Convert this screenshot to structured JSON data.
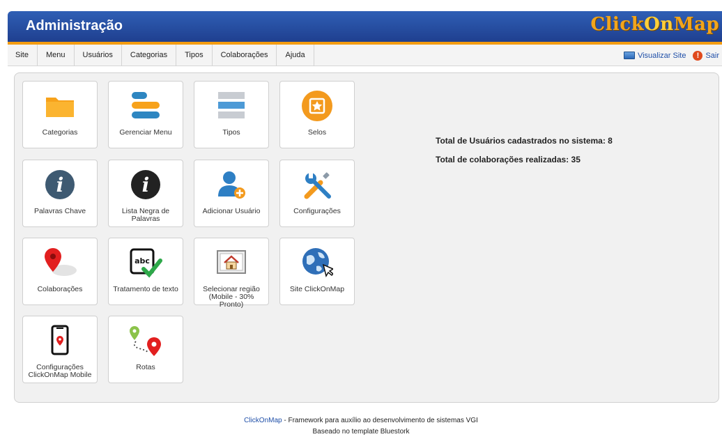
{
  "header": {
    "title": "Administração",
    "logo": {
      "part1": "Click",
      "part2": "On",
      "part3": "Map"
    }
  },
  "menu": {
    "items": [
      "Site",
      "Menu",
      "Usuários",
      "Categorias",
      "Tipos",
      "Colaborações",
      "Ajuda"
    ],
    "visit_site": "Visualizar Site",
    "logout": "Sair"
  },
  "tiles": [
    {
      "label": "Categorias",
      "icon": "folder-icon"
    },
    {
      "label": "Gerenciar Menu",
      "icon": "menu-bars-icon"
    },
    {
      "label": "Tipos",
      "icon": "list-icon"
    },
    {
      "label": "Selos",
      "icon": "star-badge-icon"
    },
    {
      "label": "Palavras Chave",
      "icon": "info-icon"
    },
    {
      "label": "Lista Negra de Palavras",
      "icon": "info-dark-icon"
    },
    {
      "label": "Adicionar Usuário",
      "icon": "add-user-icon"
    },
    {
      "label": "Configurações",
      "icon": "tools-icon"
    },
    {
      "label": "Colaborações",
      "icon": "map-pin-icon"
    },
    {
      "label": "Tratamento de texto",
      "icon": "spellcheck-icon"
    },
    {
      "label": "Selecionar região (Mobile - 30% Pronto)",
      "icon": "home-frame-icon"
    },
    {
      "label": "Site ClickOnMap",
      "icon": "globe-icon"
    },
    {
      "label": "Configurações ClickOnMap Mobile",
      "icon": "mobile-icon"
    },
    {
      "label": "Rotas",
      "icon": "route-icon"
    }
  ],
  "stats": {
    "users": "Total de Usuários cadastrados no sistema: 8",
    "collaborations": "Total de colaborações realizadas: 35"
  },
  "footer": {
    "link": "ClickOnMap",
    "text1": " - Framework para auxílio ao desenvolvimento de sistemas VGI",
    "text2": "Baseado no template Bluestork"
  }
}
